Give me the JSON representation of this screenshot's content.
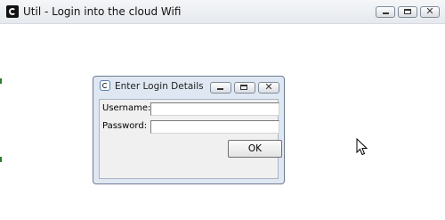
{
  "main_window": {
    "title": "Util - Login into the cloud Wifi",
    "icon": "app-swirl-icon"
  },
  "dialog": {
    "title": "Enter Login Details",
    "icon": "app-swirl-icon",
    "username_label": "Username:",
    "username_value": "",
    "password_label": "Password:",
    "password_value": "",
    "ok_label": "OK"
  },
  "colors": {
    "dialog_frame": "#dfe8f2",
    "client_bg": "#f0f0f0"
  }
}
